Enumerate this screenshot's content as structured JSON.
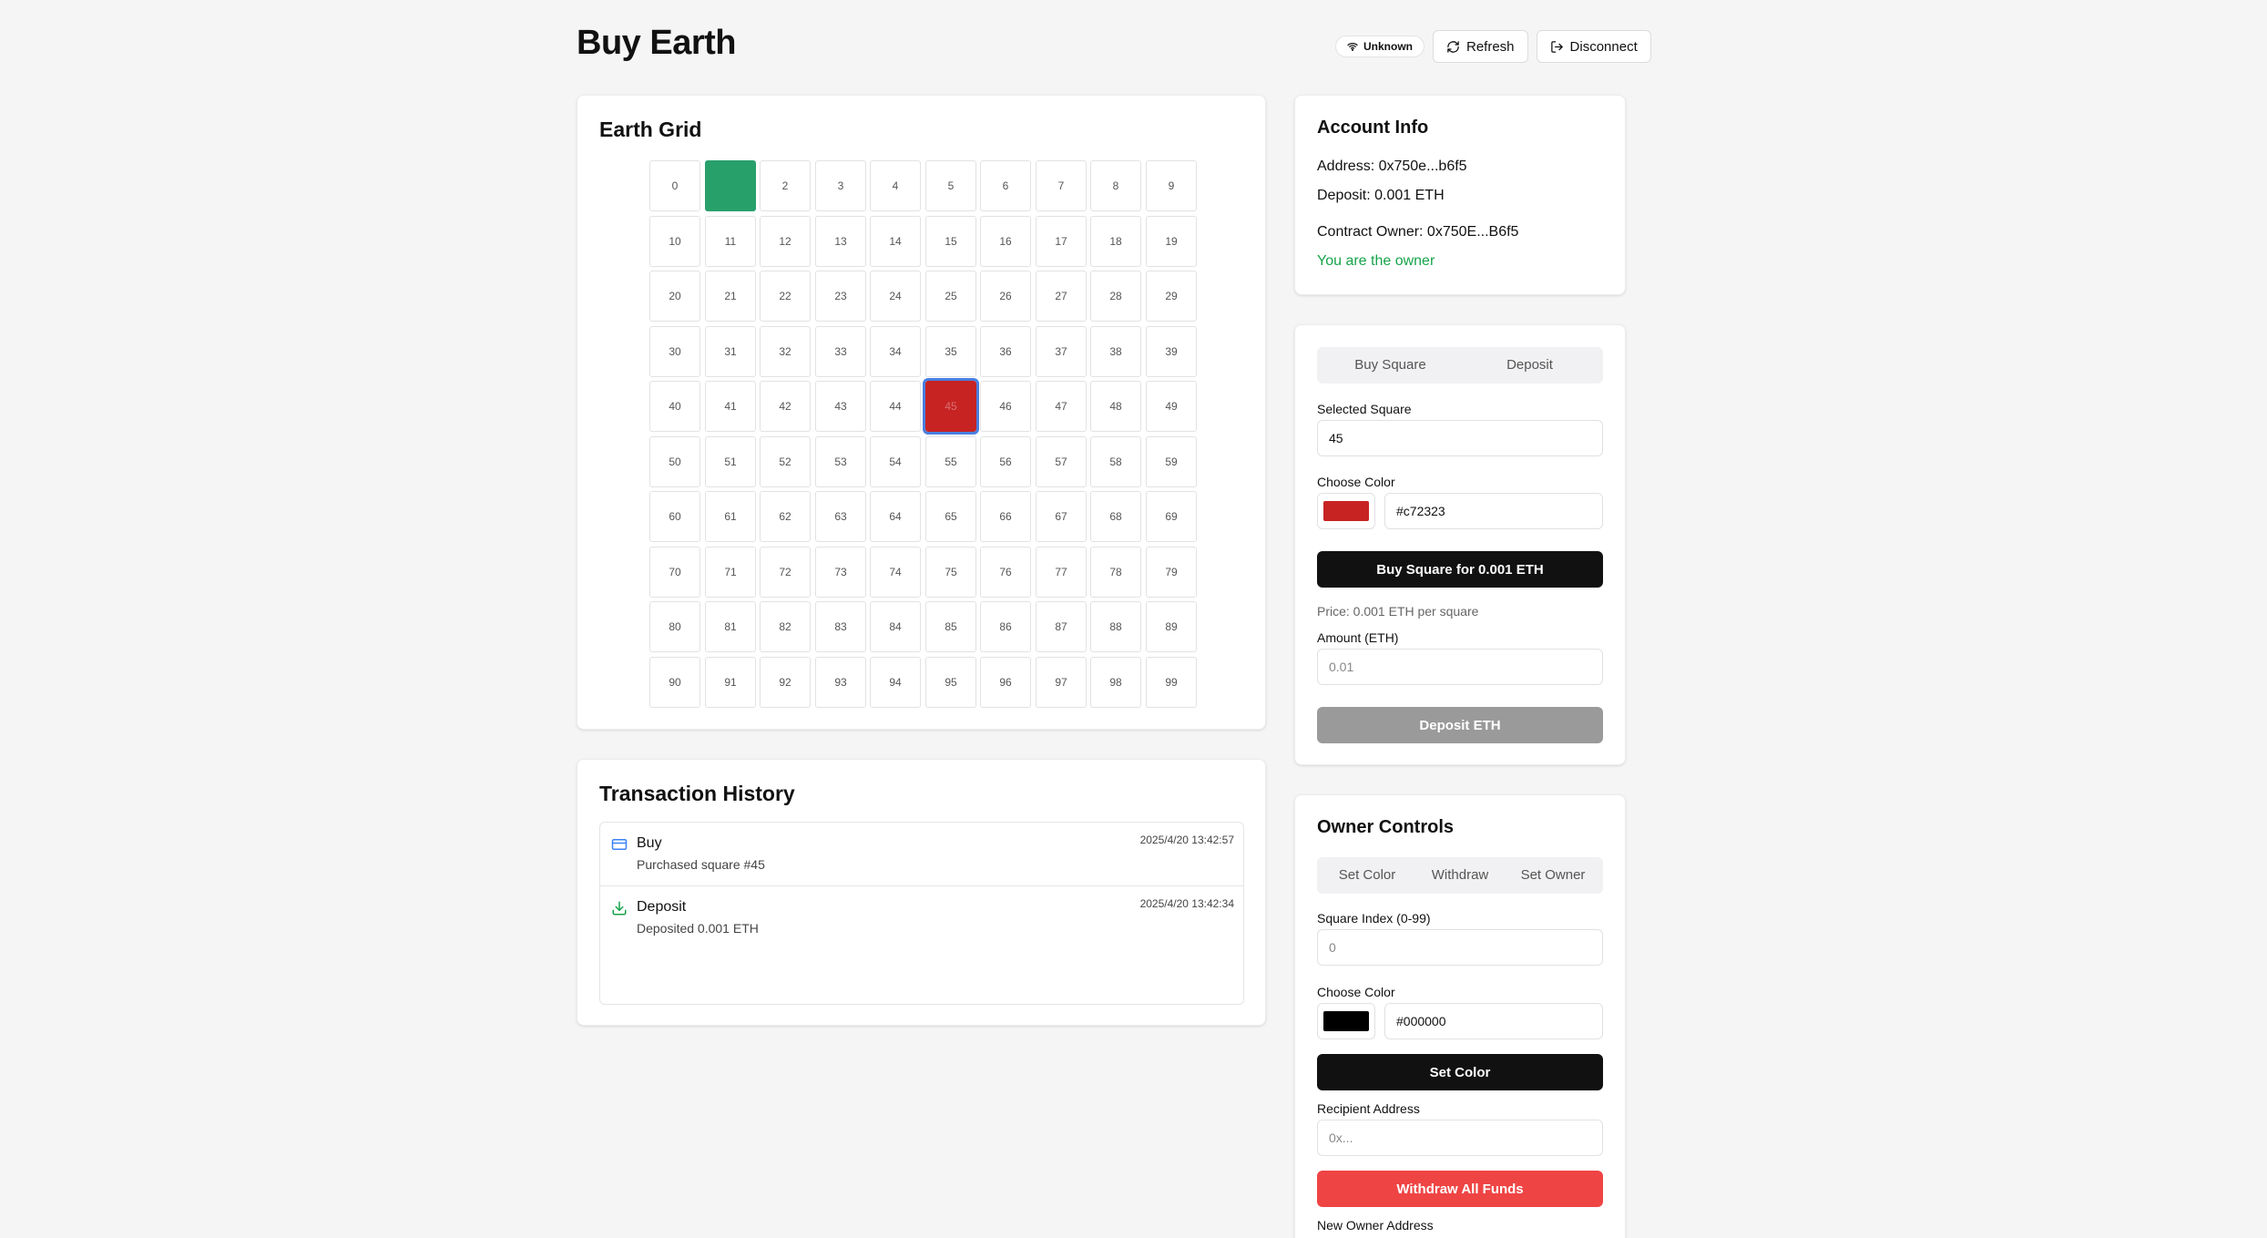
{
  "header": {
    "title": "Buy Earth",
    "network_label": "Unknown",
    "refresh_label": "Refresh",
    "disconnect_label": "Disconnect"
  },
  "grid": {
    "title": "Earth Grid",
    "owned": [
      {
        "index": 1,
        "color": "#27a06a"
      },
      {
        "index": 45,
        "color": "#c72323"
      }
    ],
    "selected": 45
  },
  "account": {
    "title": "Account Info",
    "address": "Address: 0x750e...b6f5",
    "deposit": "Deposit: 0.001 ETH",
    "contract_owner": "Contract Owner: 0x750E...B6f5",
    "owner_note": "You are the owner"
  },
  "buy": {
    "tabs": [
      "Buy Square",
      "Deposit"
    ],
    "selected_label": "Selected Square",
    "selected_value": "45",
    "color_label": "Choose Color",
    "color_value": "#c72323",
    "buy_button": "Buy Square for 0.001 ETH",
    "price_text": "Price: 0.001 ETH per square",
    "amount_label": "Amount (ETH)",
    "amount_placeholder": "0.01",
    "deposit_button": "Deposit ETH"
  },
  "transactions": {
    "title": "Transaction History",
    "items": [
      {
        "type": "Buy",
        "desc": "Purchased square #45",
        "time": "2025/4/20 13:42:57",
        "icon": "card-icon"
      },
      {
        "type": "Deposit",
        "desc": "Deposited 0.001 ETH",
        "time": "2025/4/20 13:42:34",
        "icon": "download-icon"
      }
    ]
  },
  "owner": {
    "title": "Owner Controls",
    "tabs": [
      "Set Color",
      "Withdraw",
      "Set Owner"
    ],
    "index_label": "Square Index (0-99)",
    "index_placeholder": "0",
    "color_label": "Choose Color",
    "color_value": "#000000",
    "set_color_button": "Set Color",
    "recipient_label": "Recipient Address",
    "recipient_placeholder": "0x...",
    "withdraw_button": "Withdraw All Funds",
    "new_owner_label": "New Owner Address"
  },
  "colors": {
    "primary": "#111111",
    "danger": "#ef4444",
    "disabled": "#9a9a9a",
    "success": "#16a34a",
    "selected_outline": "#4a7fe0"
  }
}
